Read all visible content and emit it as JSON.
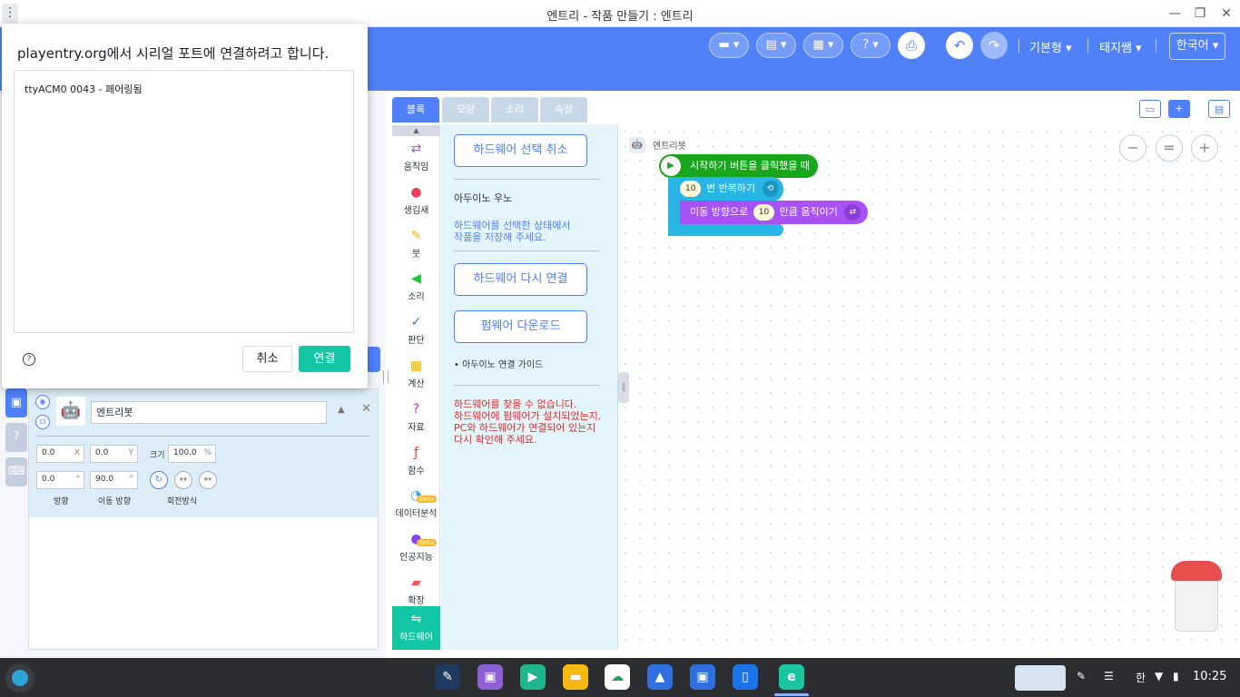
{
  "window": {
    "title": "엔트리 - 작품 만들기 : 엔트리",
    "menu_icon": "⋮",
    "minimize": "—",
    "restore": "❐",
    "close": "✕"
  },
  "header": {
    "mode_label": "기본형",
    "user_label": "태지쌤",
    "language": "한국어"
  },
  "dialog": {
    "title": "playentry.org에서 시리얼 포트에 연결하려고 합니다.",
    "port_item": "ttyACM0 0043 - 페어링됨",
    "cancel": "취소",
    "connect": "연결"
  },
  "tabs": [
    "블록",
    "모양",
    "소리",
    "속성"
  ],
  "categories": [
    {
      "label": "움직임",
      "icon": "move-icon",
      "color": "#a751f8"
    },
    {
      "label": "생김새",
      "icon": "looks-icon",
      "color": "#ed3f5b"
    },
    {
      "label": "붓",
      "icon": "brush-icon",
      "color": "#ffb213"
    },
    {
      "label": "소리",
      "icon": "sound-icon",
      "color": "#1bc33b"
    },
    {
      "label": "판단",
      "icon": "judge-icon",
      "color": "#3e6ff3"
    },
    {
      "label": "계산",
      "icon": "calc-icon",
      "color": "#fab013"
    },
    {
      "label": "자료",
      "icon": "data-icon",
      "color": "#be35d5"
    },
    {
      "label": "함수",
      "icon": "func-icon",
      "color": "#f73c25"
    },
    {
      "label": "데이터분석",
      "icon": "analysis-icon",
      "color": "#36a4f5",
      "badge": "Beta"
    },
    {
      "label": "인공지능",
      "icon": "ai-icon",
      "color": "#8a43e8",
      "badge": "Beta"
    },
    {
      "label": "확장",
      "icon": "extend-icon",
      "color": "#f5595b"
    },
    {
      "label": "하드웨어",
      "icon": "hardware-icon",
      "color": "#13c6a5"
    }
  ],
  "palette": {
    "cancel_select": "하드웨어 선택 취소",
    "device_name": "아두이노 우노",
    "save_notice_1": "하드웨어를 선택한 상태에서",
    "save_notice_2": "작품을 저장해 주세요.",
    "reconnect": "하드웨어 다시 연결",
    "firmware": "펌웨어 다운로드",
    "guide": "아두이노 연결 가이드",
    "error_1": "하드웨어를 찾을 수 없습니다.",
    "error_2": "하드웨어에 펌웨어가 설치되었는지,",
    "error_3": "PC와 하드웨어가 연결되어 있는지",
    "error_4": "다시 확인해 주세요."
  },
  "workspace": {
    "object_label": "엔트리봇",
    "start_block": "시작하기 버튼을 클릭했을 때",
    "repeat_count": "10",
    "repeat_label": "번 반복하기",
    "move_prefix": "이동 방향으로",
    "move_value": "10",
    "move_suffix": "만큼 움직이기"
  },
  "object": {
    "name": "엔트리봇",
    "x": "0.0",
    "x_unit": "X",
    "y": "0.0",
    "y_unit": "Y",
    "size_label": "크기",
    "size": "100.0",
    "size_unit": "%",
    "direction": "0.0",
    "move_direction": "90.0",
    "degree_unit": "°",
    "direction_label": "방향",
    "move_direction_label": "이동 방향",
    "rotation_label": "회전방식"
  },
  "shelf": {
    "ime": "한",
    "time": "10:25"
  },
  "colors": {
    "brand_blue": "#5081f9",
    "accent_green": "#13c6a5",
    "start_block": "#18a61c",
    "repeat_block": "#27b6e5",
    "move_block": "#a751f8",
    "error_red": "#e42828"
  }
}
